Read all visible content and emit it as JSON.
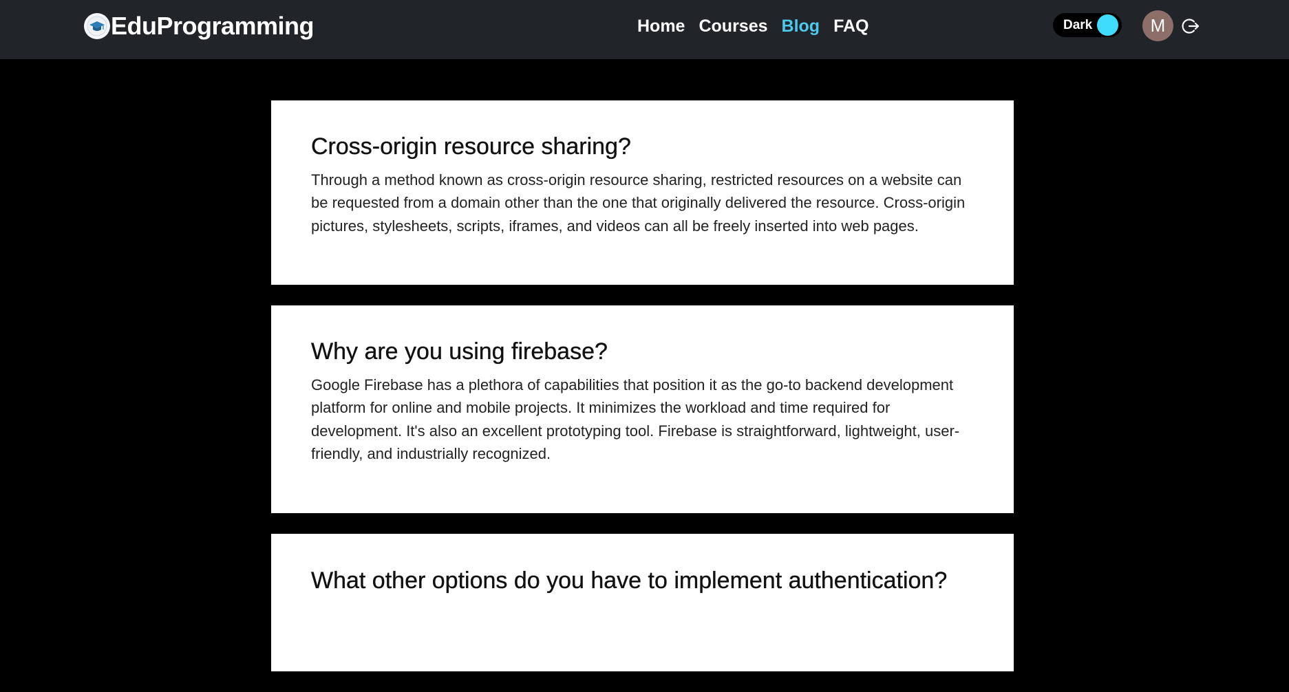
{
  "navbar": {
    "brand": "EduProgramming",
    "links": [
      {
        "label": "Home",
        "active": false
      },
      {
        "label": "Courses",
        "active": false
      },
      {
        "label": "Blog",
        "active": true
      },
      {
        "label": "FAQ",
        "active": false
      }
    ],
    "theme_toggle_label": "Dark",
    "avatar_initial": "M",
    "colors": {
      "background": "#212529",
      "active_link": "#4dc9ee",
      "toggle_knob": "#3fdcfb",
      "avatar": "#8d6e69"
    }
  },
  "posts": [
    {
      "title": "Cross-origin resource sharing?",
      "body": "Through a method known as cross-origin resource sharing, restricted resources on a website can be requested from a domain other than the one that originally delivered the resource. Cross-origin pictures, stylesheets, scripts, iframes, and videos can all be freely inserted into web pages."
    },
    {
      "title": "Why are you using firebase?",
      "body": "Google Firebase has a plethora of capabilities that position it as the go-to backend development platform for online and mobile projects. It minimizes the workload and time required for development. It's also an excellent prototyping tool. Firebase is straightforward, lightweight, user-friendly, and industrially recognized."
    },
    {
      "title": "What other options do you have to implement authentication?",
      "body": ""
    }
  ],
  "page_background": "#000000"
}
